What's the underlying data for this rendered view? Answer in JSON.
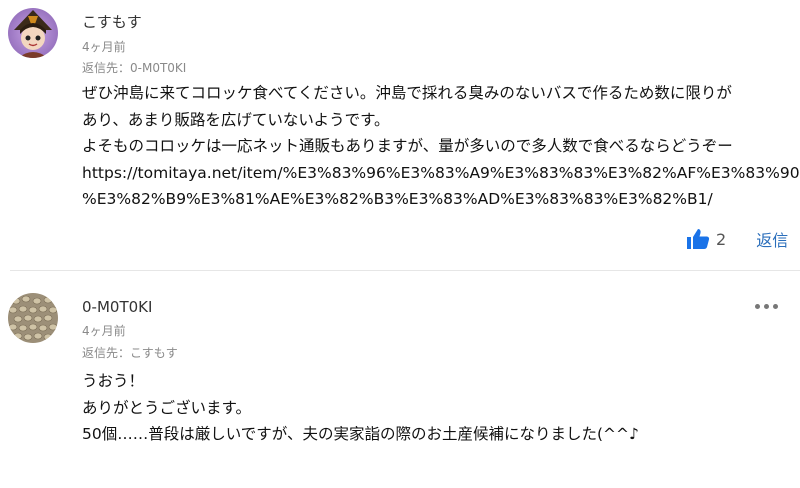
{
  "comments": [
    {
      "author": "こすもす",
      "time": "4ヶ月前",
      "reply_to": "返信先：0-M0T0KI",
      "lines": [
        "ぜひ沖島に来てコロッケ食べてください。沖島で採れる臭みのないバスで作るため数に限りが",
        "あり、あまり販路を広げていないようです。",
        "よそものコロッケは一応ネット通販もありますが、量が多いので多人数で食べるならどうぞー",
        "https://tomitaya.net/item/%E3%83%96%E3%83%A9%E3%83%83%E3%82%AF%E3%83%90",
        "%E3%82%B9%E3%81%AE%E3%82%B3%E3%83%AD%E3%83%83%E3%82%B1/"
      ],
      "likes": "2",
      "reply_label": "返信",
      "avatar_icon": "anime-character-avatar"
    },
    {
      "author": "0-M0T0KI",
      "time": "4ヶ月前",
      "reply_to": "返信先：こすもす",
      "lines": [
        "うおう！",
        "ありがとうございます。",
        "50個……普段は厳しいですが、夫の実家詣の際のお土産候補になりました(^^♪"
      ],
      "avatar_icon": "seeds-avatar"
    }
  ],
  "colors": {
    "like_icon": "#1a73e8",
    "reply_link": "#2a6ebb",
    "meta_text": "#8a8a8a"
  }
}
